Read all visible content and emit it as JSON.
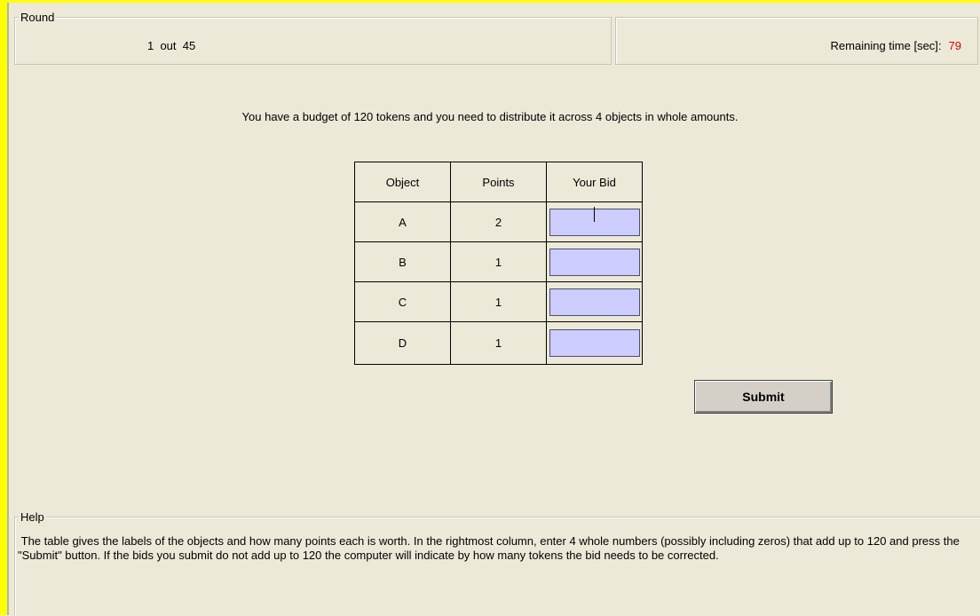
{
  "round": {
    "title": "Round",
    "value": "1  out  45"
  },
  "timer": {
    "label": "Remaining time [sec]:",
    "value": "79",
    "value_color": "#e00000"
  },
  "instructions": "You have a budget of 120 tokens and you need to distribute it across 4 objects in whole amounts.",
  "table": {
    "headers": [
      "Object",
      "Points",
      "Your Bid"
    ],
    "rows": [
      {
        "object": "A",
        "points": "2",
        "bid": ""
      },
      {
        "object": "B",
        "points": "1",
        "bid": ""
      },
      {
        "object": "C",
        "points": "1",
        "bid": ""
      },
      {
        "object": "D",
        "points": "1",
        "bid": ""
      }
    ]
  },
  "submit_label": "Submit",
  "help": {
    "title": "Help",
    "text": " The table gives the labels of the objects and how many points each is worth. In the rightmost column, enter 4 whole numbers (possibly including zeros) that add up to 120 and press the \"Submit\" button. If the bids you submit do not add up to 120 the computer will indicate by how many tokens the bid needs to be corrected."
  },
  "colors": {
    "frame": "#ffff00",
    "background": "#ece9d8",
    "input_bg": "#ccccff"
  }
}
